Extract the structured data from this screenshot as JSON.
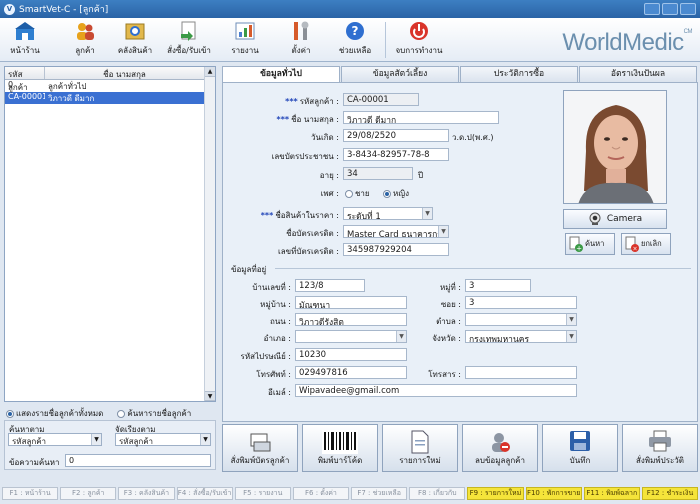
{
  "window": {
    "title": "SmartVet-C - [ลูกค้า]"
  },
  "toolbar": {
    "items": [
      {
        "label": "หน้าร้าน",
        "color": "#2f7fd0"
      },
      {
        "label": "ลูกค้า",
        "color": "#e7a21c"
      },
      {
        "label": "คลังสินค้า",
        "color": "#e2b84c"
      },
      {
        "label": "สั่งซื้อ/รับเข้า",
        "color": "#3b9a46"
      },
      {
        "label": "รายงาน",
        "color": "#4b7fd0"
      },
      {
        "label": "ตั้งค่า",
        "color": "#d65a2a"
      },
      {
        "label": "ช่วยเหลือ",
        "color": "#2f6fd0"
      },
      {
        "label": "จบการทำงาน",
        "color": "#d9342a"
      }
    ],
    "logo": "WorldMedic",
    "logo_sup": "CM"
  },
  "customer_list": {
    "columns": [
      "รหัสลูกค้า",
      "ชื่อ นามสกุล"
    ],
    "rows": [
      {
        "code": "0",
        "name": "ลูกค้าทั่วไป"
      },
      {
        "code": "CA-00001",
        "name": "วิภาวดี ดีมาก"
      }
    ],
    "radio_show_all": "แสดงรายชื่อลูกค้าทั้งหมด",
    "radio_search": "ค้นหารายชื่อลูกค้า",
    "search_by_label": "ค้นหาตาม",
    "search_by_value": "รหัสลูกค้า",
    "sort_by_label": "จัดเรียงตาม",
    "sort_by_value": "รหัสลูกค้า",
    "found_count_label": "ข้อความค้นหา",
    "found_count_value": "0"
  },
  "tabs": [
    "ข้อมูลทั่วไป",
    "ข้อมูลสัตว์เลี้ยง",
    "ประวัติการซื้อ",
    "อัตราเงินปันผล"
  ],
  "general": {
    "required_mark": "***",
    "customer_code_label": "รหัสลูกค้า :",
    "customer_code": "CA-00001",
    "full_name_label": "ชื่อ นามสกุล :",
    "full_name": "วิภาวดี ดีมาก",
    "birth_date_label": "วันเกิด :",
    "birth_date": "29/08/2520",
    "era": "ว.ด.ป(พ.ศ.)",
    "id_card_label": "เลขบัตรประชาชน :",
    "id_card": "3-8434-82957-78-8",
    "age_label": "อายุ :",
    "age": "34",
    "age_unit": "ปี",
    "gender_label": "เพศ :",
    "gender_male": "ชาย",
    "gender_female": "หญิง",
    "price_level_label": "ชื่อสินค้าในราคา :",
    "price_level": "ระดับที่ 1",
    "card_name_label": "ชื่อบัตรเครดิต :",
    "card_name": "Master Card ธนาคารกรุ",
    "card_number_label": "เลขที่บัตรเครดิต :",
    "card_number": "345987929204",
    "camera_label": "Camera",
    "browse_label": "ค้นหา",
    "cancel_label": "ยกเลิก"
  },
  "address": {
    "section_title": "ข้อมูลที่อยู่",
    "house_no_label": "บ้านเลขที่ :",
    "house_no": "123/8",
    "moo_label": "หมู่ที่ :",
    "moo": "3",
    "village_label": "หมู่บ้าน :",
    "village": "มัณฑนา",
    "soi_label": "ซอย :",
    "soi": "3",
    "road_label": "ถนน :",
    "road": "วิภาวดีรังสิต",
    "subdistrict_label": "ตำบล :",
    "subdistrict": "",
    "district_label": "อำเภอ :",
    "district": "",
    "province_label": "จังหวัด :",
    "province": "กรุงเทพมหานคร",
    "postcode_label": "รหัสไปรษณีย์ :",
    "postcode": "10230",
    "phone_label": "โทรศัพท์ :",
    "phone": "029497816",
    "fax_label": "โทรสาร :",
    "fax": "",
    "email_label": "อีเมล์ :",
    "email": "Wipavadee@gmail.com"
  },
  "actions": [
    {
      "label": "สั่งพิมพ์บัตรลูกค้า",
      "icon": "print-card-icon"
    },
    {
      "label": "พิมพ์บาร์โค้ด",
      "icon": "barcode-icon"
    },
    {
      "label": "รายการใหม่",
      "icon": "new-document-icon"
    },
    {
      "label": "ลบข้อมูลลูกค้า",
      "icon": "delete-customer-icon"
    },
    {
      "label": "บันทึก",
      "icon": "save-disk-icon"
    },
    {
      "label": "สั่งพิมพ์ประวัติ",
      "icon": "printer-icon"
    }
  ],
  "function_keys": [
    {
      "label": "F1 : หน้าร้าน",
      "highlight": false
    },
    {
      "label": "F2 : ลูกค้า",
      "highlight": false
    },
    {
      "label": "F3 : คลังสินค้า",
      "highlight": false
    },
    {
      "label": "F4 : สั่งซื้อ/รับเข้า",
      "highlight": false
    },
    {
      "label": "F5 : รายงาน",
      "highlight": false
    },
    {
      "label": "F6 : ตั้งค่า",
      "highlight": false
    },
    {
      "label": "F7 : ช่วยเหลือ",
      "highlight": false
    },
    {
      "label": "F8 : เกี่ยวกับ",
      "highlight": false
    },
    {
      "label": "F9 : รายการใหม่",
      "highlight": true
    },
    {
      "label": "F10 : พักการขาย",
      "highlight": true
    },
    {
      "label": "F11 : พิมพ์ฉลาก",
      "highlight": true
    },
    {
      "label": "F12 : ชำระเงิน",
      "highlight": true
    }
  ]
}
